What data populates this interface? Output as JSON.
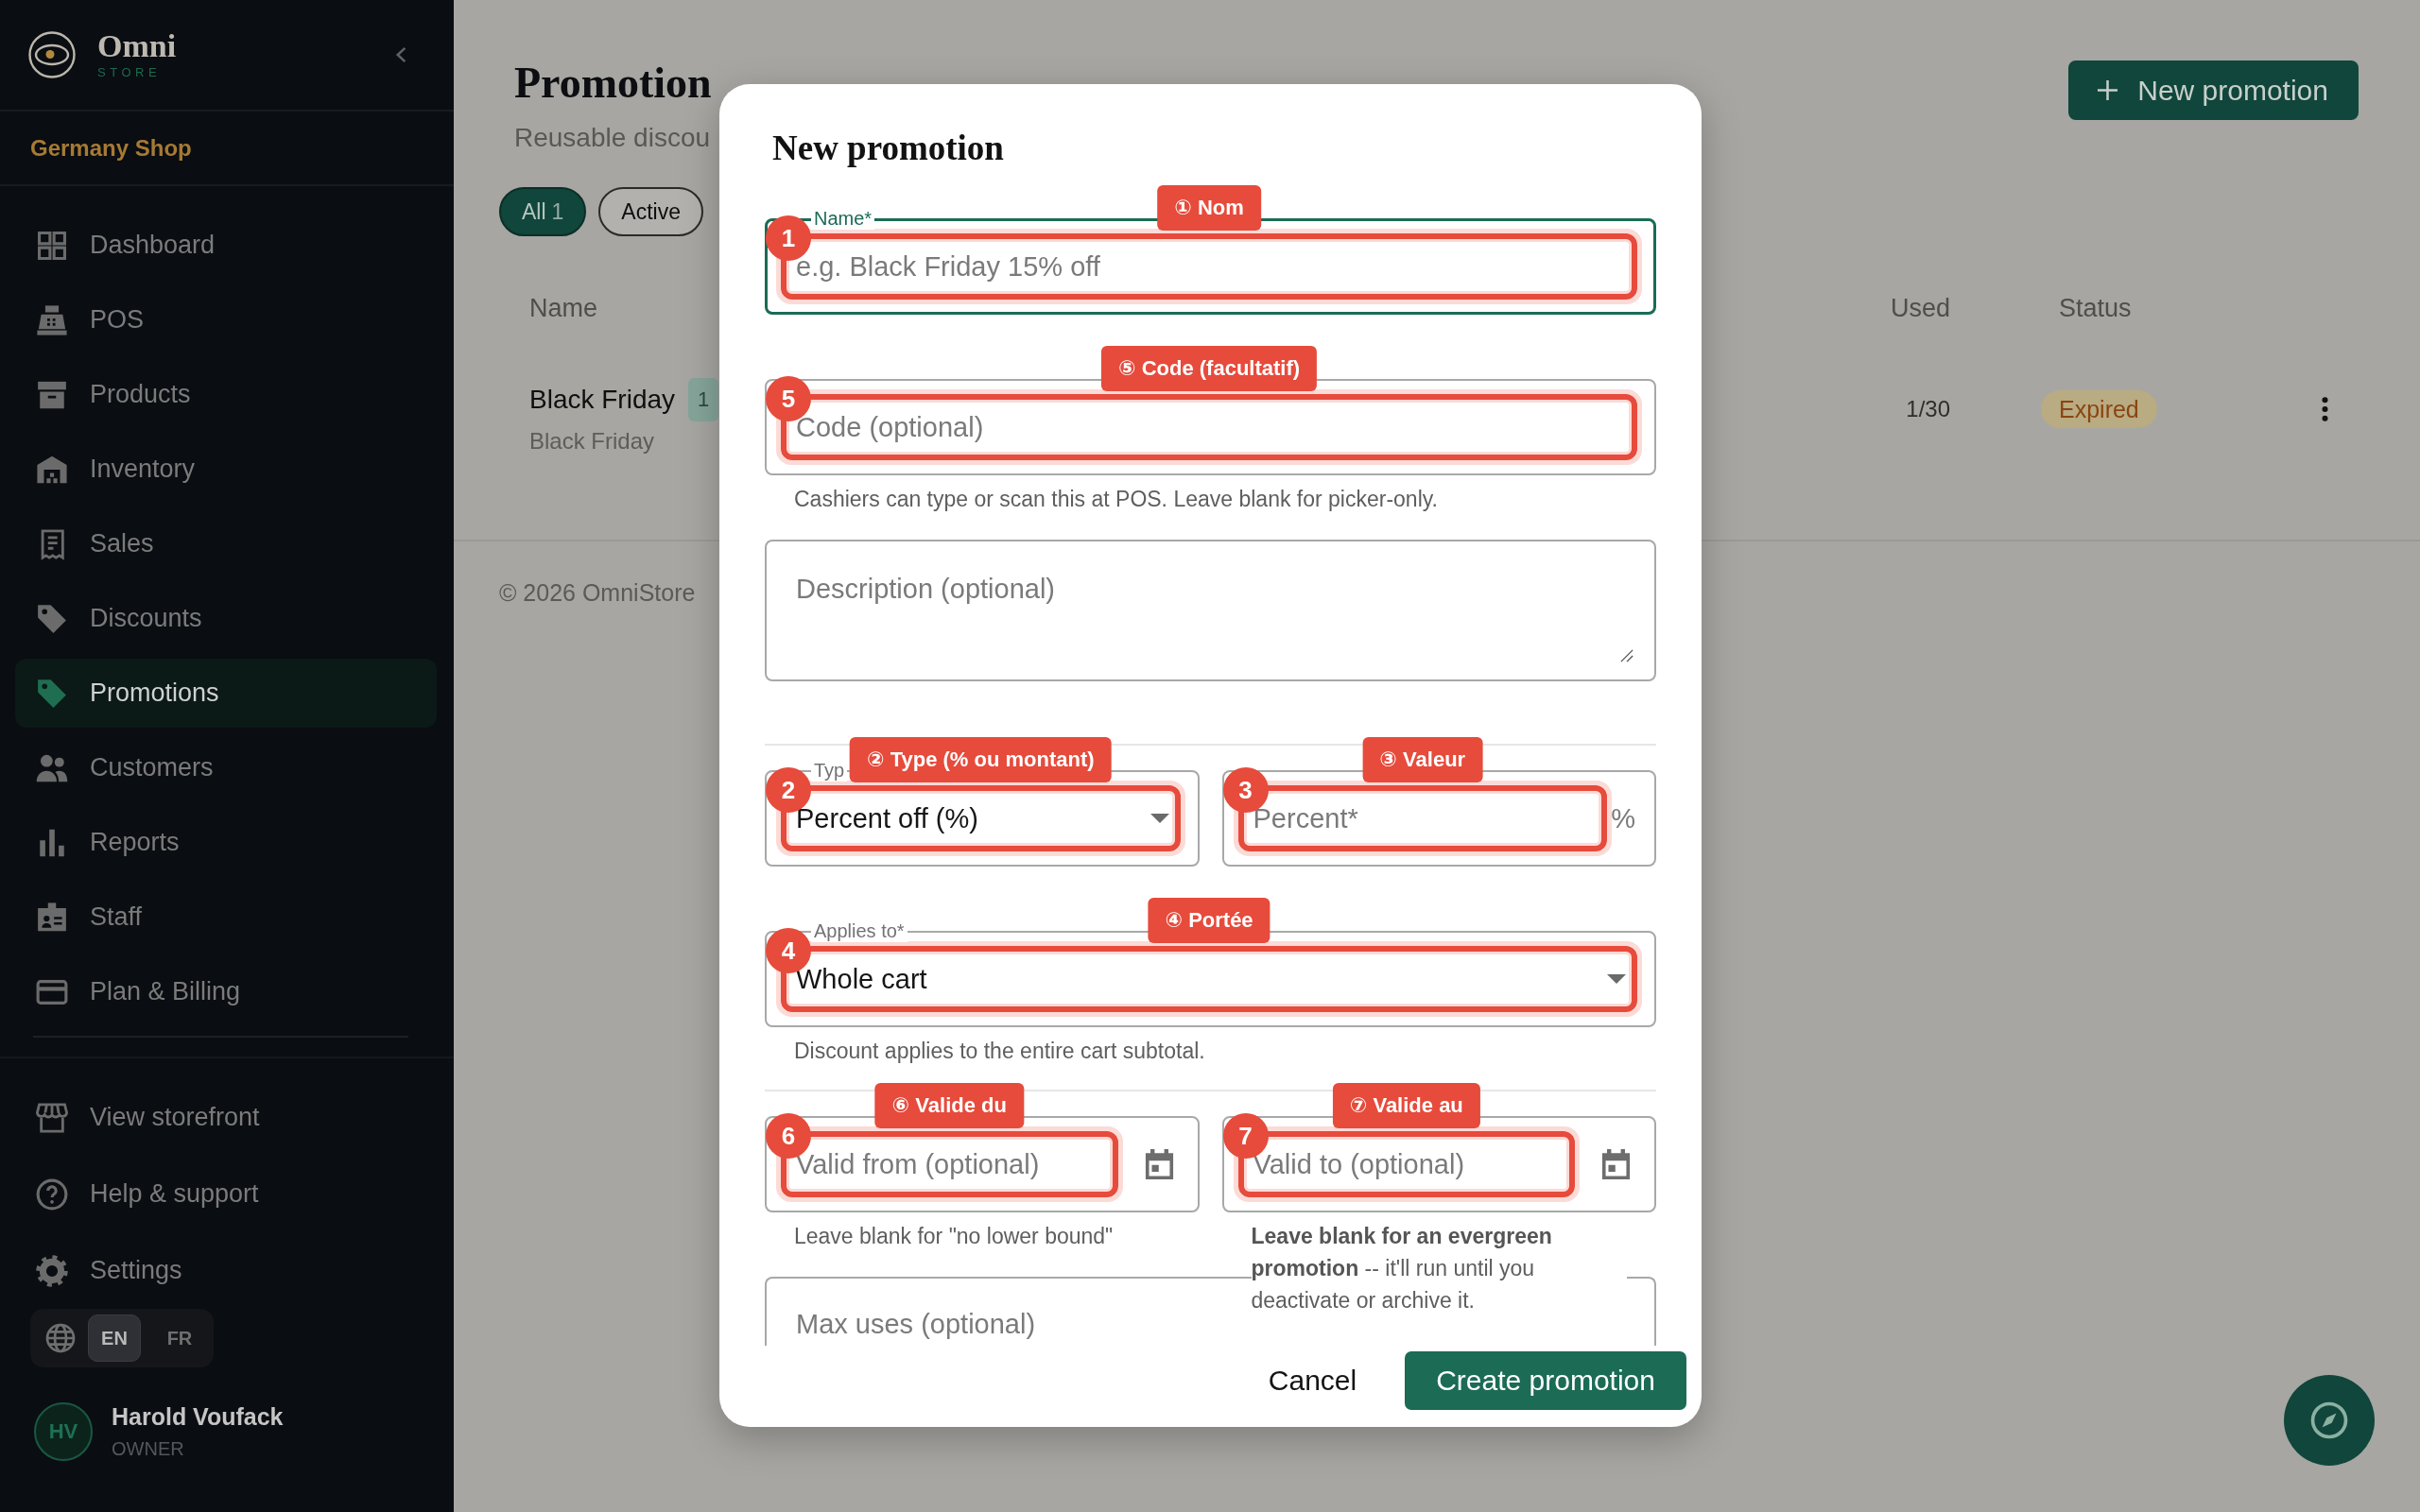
{
  "sidebar": {
    "brand": {
      "name": "Omni",
      "tagline": "STORE"
    },
    "shop": "Germany Shop",
    "nav": [
      {
        "label": "Dashboard",
        "selected": false
      },
      {
        "label": "POS",
        "selected": false
      },
      {
        "label": "Products",
        "selected": false
      },
      {
        "label": "Inventory",
        "selected": false
      },
      {
        "label": "Sales",
        "selected": false
      },
      {
        "label": "Discounts",
        "selected": false
      },
      {
        "label": "Promotions",
        "selected": true
      },
      {
        "label": "Customers",
        "selected": false
      },
      {
        "label": "Reports",
        "selected": false
      },
      {
        "label": "Staff",
        "selected": false
      },
      {
        "label": "Plan & Billing",
        "selected": false
      }
    ],
    "links": [
      {
        "label": "View storefront"
      },
      {
        "label": "Help & support"
      },
      {
        "label": "Settings"
      }
    ],
    "languages": [
      {
        "label": "EN",
        "selected": true
      },
      {
        "label": "FR",
        "selected": false
      }
    ],
    "user": {
      "initials": "HV",
      "name": "Harold Voufack",
      "role": "OWNER"
    }
  },
  "page": {
    "title": "Promotion",
    "subtitle": "Reusable discou",
    "new_button": {
      "label": "New promotion"
    },
    "filters": [
      {
        "label": "All",
        "count": "1",
        "selected": true
      },
      {
        "label": "Active",
        "selected": false
      }
    ],
    "table": {
      "columns": [
        {
          "label": "Name"
        },
        {
          "label": "Used"
        },
        {
          "label": "Status"
        }
      ],
      "rows": [
        {
          "name": "Black Friday",
          "badge": "1",
          "subtitle": "Black Friday",
          "used": "1/30",
          "status": "Expired"
        }
      ]
    },
    "footer": "© 2026 OmniStore"
  },
  "modal": {
    "title": "New promotion",
    "rows": [
      {
        "kind": "fields",
        "fields": [
          {
            "kind": "text",
            "label": "Name*",
            "placeholder": "e.g. Black Friday 15% off",
            "focused": true,
            "annotation": {
              "number": "1",
              "tag": "① Nom"
            }
          }
        ]
      },
      {
        "kind": "fields",
        "fields": [
          {
            "kind": "text",
            "placeholder": "Code (optional)",
            "focused": false,
            "helper": "Cashiers can type or scan this at POS. Leave blank for picker-only.",
            "annotation": {
              "number": "5",
              "tag": "⑤ Code (facultatif)"
            }
          }
        ]
      },
      {
        "kind": "fields",
        "fields": [
          {
            "kind": "textarea",
            "placeholder": "Description (optional)",
            "focused": false
          }
        ]
      },
      {
        "kind": "divider"
      },
      {
        "kind": "fields",
        "fields": [
          {
            "kind": "select",
            "label": "Typ",
            "value": "Percent off (%)",
            "focused": false,
            "annotation": {
              "number": "2",
              "tag": "② Type (% ou montant)"
            }
          },
          {
            "kind": "text",
            "placeholder": "Percent*",
            "suffix": "%",
            "focused": false,
            "annotation": {
              "number": "3",
              "tag": "③ Valeur"
            }
          }
        ]
      },
      {
        "kind": "fields",
        "fields": [
          {
            "kind": "select",
            "label": "Applies to*",
            "value": "Whole cart",
            "focused": false,
            "helper": "Discount applies to the entire cart subtotal.",
            "annotation": {
              "number": "4",
              "tag": "④ Portée"
            }
          }
        ]
      },
      {
        "kind": "divider"
      },
      {
        "kind": "fields",
        "fields": [
          {
            "kind": "date",
            "placeholder": "Valid from (optional)",
            "focused": false,
            "helper": "Leave blank for \"no lower bound\"",
            "annotation": {
              "number": "6",
              "tag": "⑥ Valide du"
            }
          },
          {
            "kind": "date",
            "placeholder": "Valid to (optional)",
            "focused": false,
            "helper": "**Leave blank for an evergreen promotion** -- it'll run until you deactivate or archive it.",
            "annotation": {
              "number": "7",
              "tag": "⑦ Valide au"
            }
          }
        ]
      },
      {
        "kind": "fields",
        "fields": [
          {
            "kind": "text",
            "placeholder": "Max uses (optional)",
            "focused": false
          }
        ]
      }
    ],
    "buttons": [
      {
        "kind": "text",
        "label": "Cancel"
      },
      {
        "kind": "primary",
        "label": "Create promotion"
      }
    ]
  }
}
